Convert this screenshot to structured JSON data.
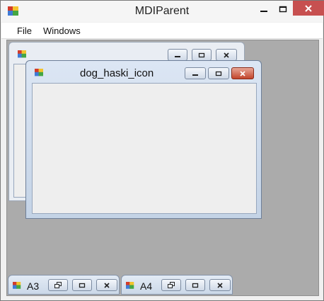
{
  "window": {
    "title": "MDIParent"
  },
  "menu": {
    "items": [
      "File",
      "Windows"
    ]
  },
  "children": {
    "back": {
      "title": ""
    },
    "front": {
      "title": "dog_haski_icon"
    }
  },
  "minimized": [
    {
      "title": "A3"
    },
    {
      "title": "A4"
    }
  ],
  "colors": {
    "close_red": "#c75050",
    "mdi_background": "#ababab"
  }
}
